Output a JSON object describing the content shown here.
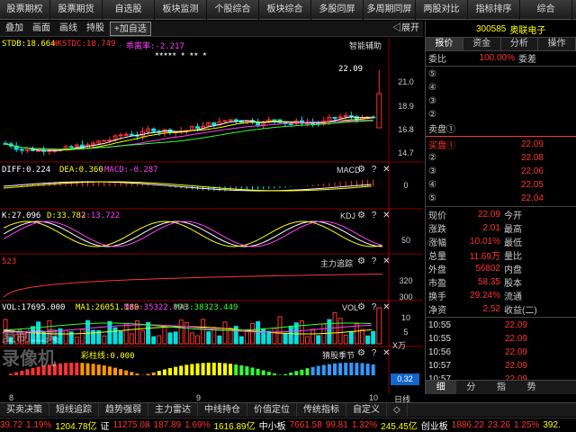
{
  "topmenu": [
    "股票期权",
    "股票期货",
    "自选股",
    "板块监测",
    "个股综合",
    "板块综合",
    "多股同屏",
    "多周期同屏",
    "两股对比",
    "指标排序",
    "综合"
  ],
  "toolbar": {
    "items": [
      "叠加",
      "画面",
      "画线",
      "持股"
    ],
    "add_fav": "+加自选",
    "expand": "◁展开"
  },
  "colors": {
    "up": "#ff3333",
    "down": "#00e0e0",
    "yellow": "#ffff00",
    "white": "#ffffff",
    "magenta": "#ff40ff",
    "green": "#33ff33",
    "accent_red": "#ff0000"
  },
  "main_pane": {
    "legend_stdb": "STDB:18.664",
    "legend_hkstdc": "HKSTDC:18.749",
    "legend_rate": "乖离率:-2.217",
    "title": "智能辅助",
    "stars": "★★★★★   ★    ★★         ★",
    "price_label": "22.09",
    "yticks": [
      "21.0",
      "18.9",
      "16.8",
      "14.7"
    ]
  },
  "macd_pane": {
    "diff": "DIFF:0.224",
    "dea": "DEA:0.360",
    "macd": "MACD:-0.287",
    "title": "MACD",
    "ctrl": "⚙ ? ✕",
    "ytick": "0"
  },
  "kdj_pane": {
    "k": "K:27.096",
    "d": "D:33.782",
    "j": "J:13.722",
    "title": "KDJ",
    "ctrl": "⚙ ? ✕",
    "ytick": "50"
  },
  "zl_pane": {
    "title": "主力追踪",
    "ctrl": "⚙ ? ✕",
    "left_val": "523",
    "yticks": [
      "320",
      "300"
    ]
  },
  "vol_pane": {
    "vol": "VOL:17695.000",
    "ma1": "MA1:26051.180",
    "ma2": "MA2:35322.898",
    "ma3": "MA3:38323.449",
    "title": "VOL",
    "ctrl": "⚙ ? ✕",
    "yticks": [
      "10",
      "5"
    ],
    "unit": "X万"
  },
  "cz_pane": {
    "label": "彩柱线:0.000",
    "title": "猜股季节",
    "ctrl": "⚙ ? ✕",
    "input": "0.32"
  },
  "xaxis": {
    "labels": [
      "8",
      "9",
      "10"
    ],
    "day_label": "日线"
  },
  "watermark": {
    "line1": "复制工具",
    "line2": "录像机"
  },
  "right_panel": {
    "code": "300585",
    "name": "奥联电子",
    "tabs": [
      "报价",
      "资金",
      "分析",
      "操作"
    ],
    "weibi_label": "委比",
    "weibi_value": "100.00%",
    "weicha_label": "委差",
    "sell_levels": [
      {
        "label": "⑤",
        "price": "",
        "qty": ""
      },
      {
        "label": "④",
        "price": "",
        "qty": ""
      },
      {
        "label": "③",
        "price": "",
        "qty": ""
      },
      {
        "label": "②",
        "price": "",
        "qty": ""
      },
      {
        "label": "卖盘①",
        "price": "",
        "qty": ""
      }
    ],
    "buy_levels": [
      {
        "label": "买盘①",
        "price": "22.09"
      },
      {
        "label": "②",
        "price": "22.08"
      },
      {
        "label": "③",
        "price": "22.06"
      },
      {
        "label": "④",
        "price": "22.05"
      },
      {
        "label": "⑤",
        "price": "22.04"
      }
    ],
    "stats": [
      {
        "l": "现价",
        "v": "22.09",
        "r": "今开"
      },
      {
        "l": "涨跌",
        "v": "2.01",
        "r": "最高"
      },
      {
        "l": "涨幅",
        "v": "10.01%",
        "r": "最低"
      },
      {
        "l": "总量",
        "v": "11.69万",
        "r": "量比"
      },
      {
        "l": "外盘",
        "v": "56802",
        "r": "内盘"
      },
      {
        "l": "市盈",
        "v": "58.35",
        "r": "股本"
      },
      {
        "l": "换手",
        "v": "29.24%",
        "r": "流通"
      },
      {
        "l": "净资",
        "v": "2.52",
        "r": "收益(二)"
      }
    ],
    "trades": [
      {
        "t": "10:55",
        "p": "22.09"
      },
      {
        "t": "10:55",
        "p": "22.09"
      },
      {
        "t": "10:56",
        "p": "22.09"
      },
      {
        "t": "10:57",
        "p": "22.09"
      },
      {
        "t": "10:57",
        "p": "22.09"
      }
    ],
    "foot": [
      "细",
      "分",
      "指",
      "势",
      ""
    ]
  },
  "bottom_tabs": [
    "买卖决策",
    "短线追踪",
    "趋势强弱",
    "主力雷达",
    "中线持仓",
    "价值定位",
    "传统指标",
    "自定义",
    "◇"
  ],
  "ticker": [
    {
      "t": "39.72",
      "c": "#ff3333"
    },
    {
      "t": "1.19%",
      "c": "#ff3333"
    },
    {
      "t": "1204.78亿",
      "c": "#ffff00"
    },
    {
      "t": "证",
      "c": "#ffffff"
    },
    {
      "t": "11275.08",
      "c": "#ff3333"
    },
    {
      "t": "187.89",
      "c": "#ff3333"
    },
    {
      "t": "1.69%",
      "c": "#ff3333"
    },
    {
      "t": "1616.89亿",
      "c": "#ffff00"
    },
    {
      "t": "中小板",
      "c": "#ffffff"
    },
    {
      "t": "7661.58",
      "c": "#ff3333"
    },
    {
      "t": "99.81",
      "c": "#ff3333"
    },
    {
      "t": "1.32%",
      "c": "#ff3333"
    },
    {
      "t": "245.45亿",
      "c": "#ffff00"
    },
    {
      "t": "创业板",
      "c": "#ffffff"
    },
    {
      "t": "1886.22",
      "c": "#ff3333"
    },
    {
      "t": "23.26",
      "c": "#ff3333"
    },
    {
      "t": "1.25%",
      "c": "#ff3333"
    },
    {
      "t": "392.",
      "c": "#ffff00"
    }
  ]
}
